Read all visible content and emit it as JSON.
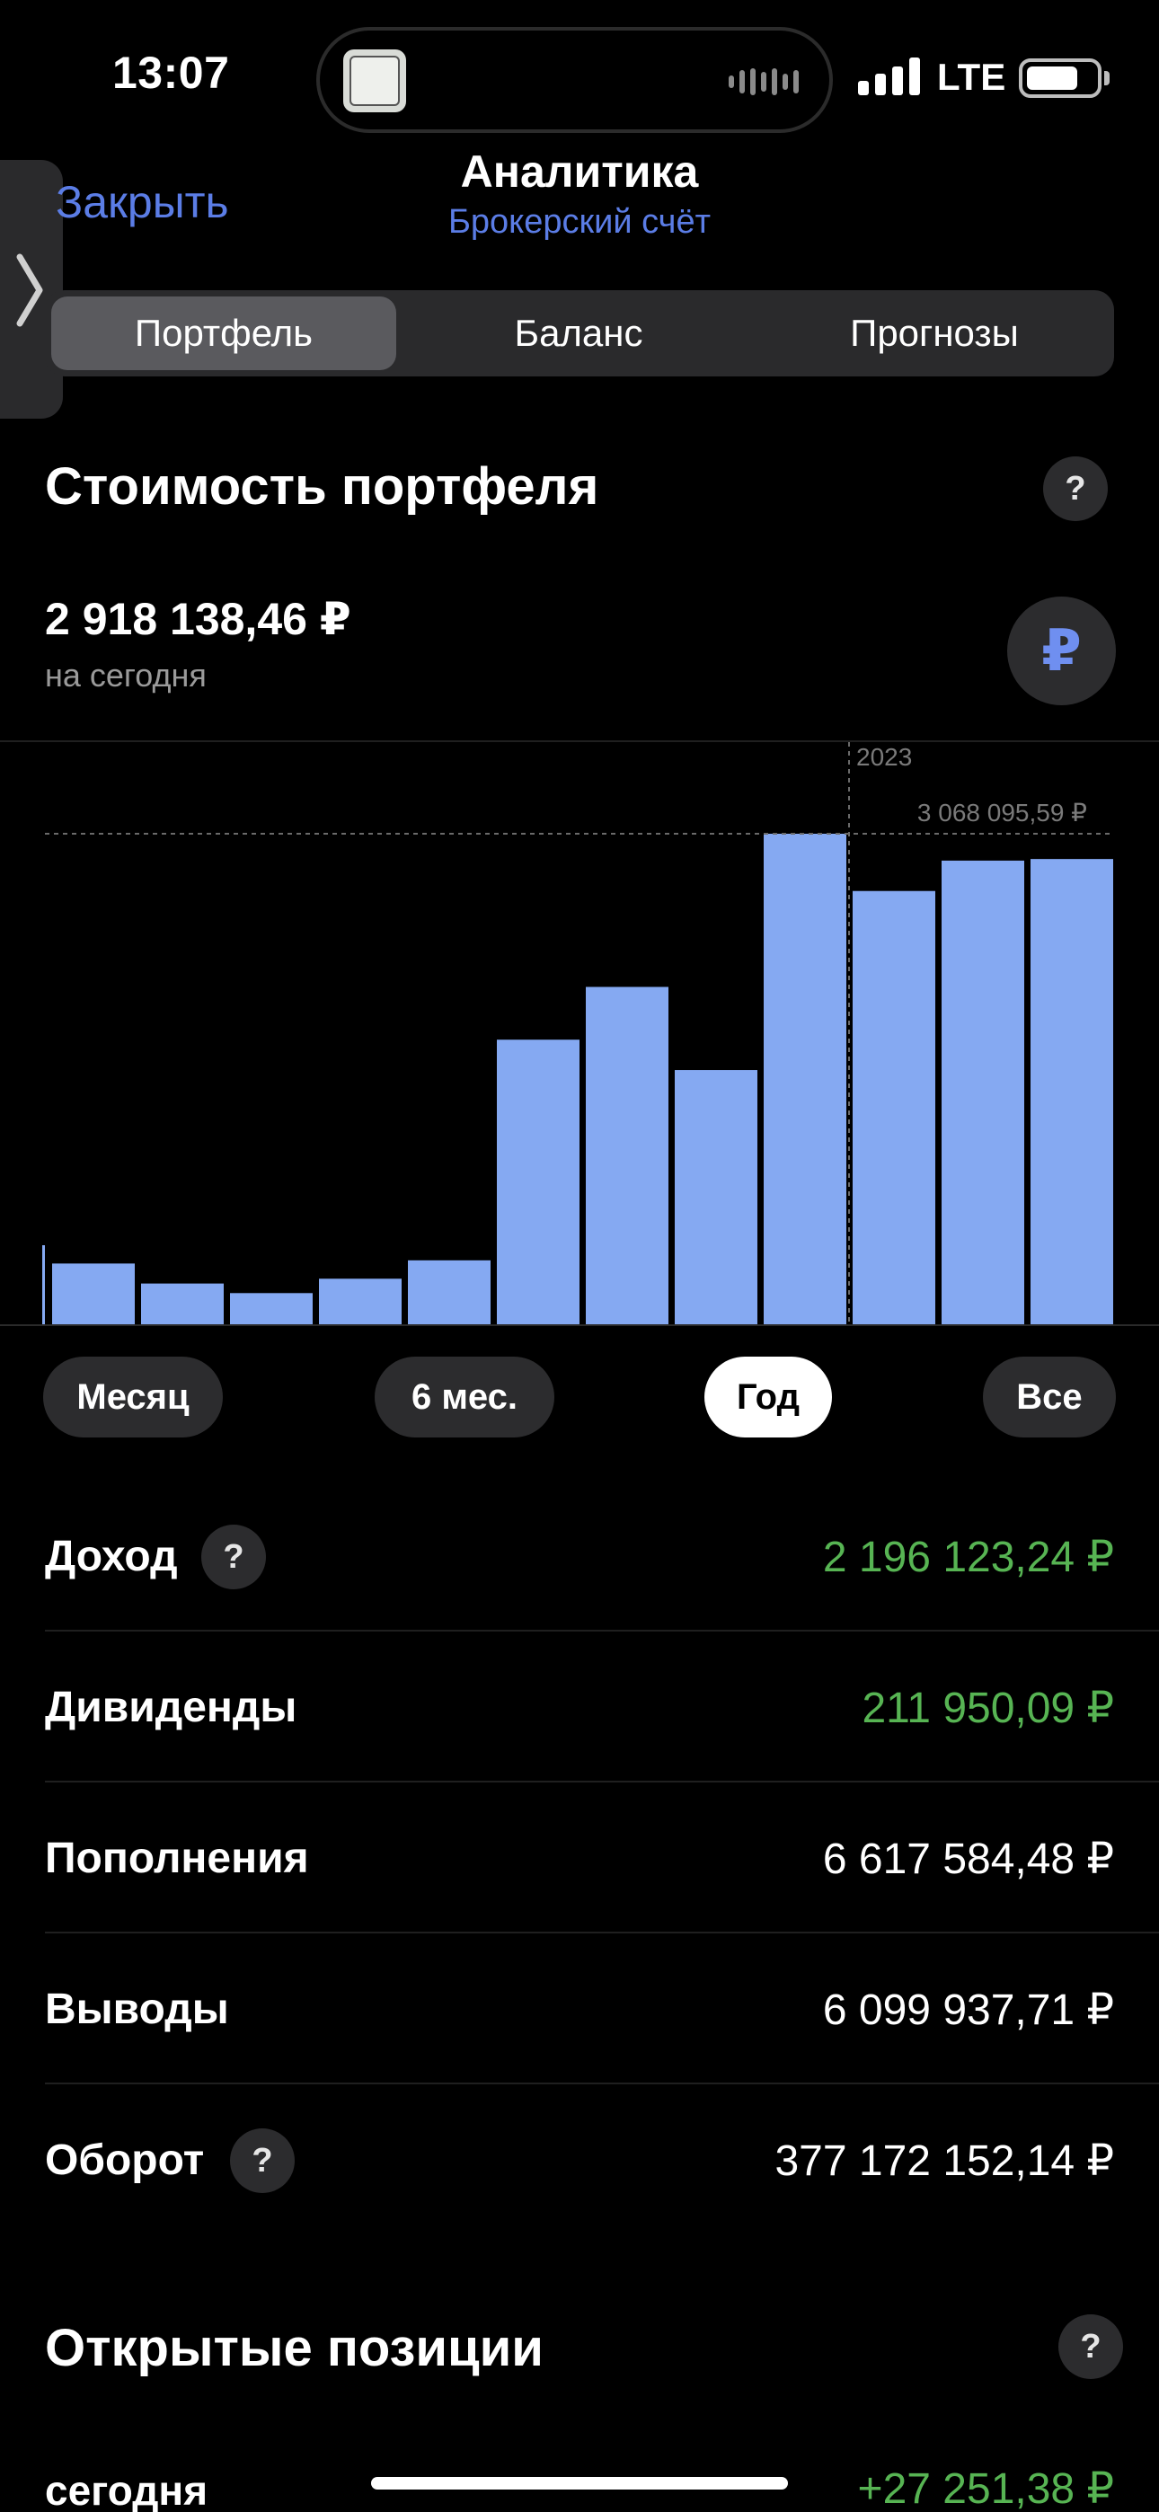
{
  "status_bar": {
    "time": "13:07",
    "network": "LTE",
    "now_playing_art_icon": "album-art-icon",
    "battery_level_percent": 75
  },
  "header": {
    "close_label": "Закрыть",
    "title": "Аналитика",
    "subtitle": "Брокерский счёт"
  },
  "tabs": [
    {
      "label": "Портфель",
      "active": true
    },
    {
      "label": "Баланс",
      "active": false
    },
    {
      "label": "Прогнозы",
      "active": false
    }
  ],
  "portfolio": {
    "title": "Стоимость портфеля",
    "help_label": "?",
    "value": "2 918 138,46 ₽",
    "value_caption": "на сегодня",
    "currency_button": "₽"
  },
  "chart_data": {
    "type": "bar",
    "marker_label": "2023",
    "max_label": "3 068 095,59 ₽",
    "max_value": 3068095.59,
    "values": [
      380000,
      255000,
      195000,
      285000,
      400000,
      1780000,
      2110000,
      1590000,
      3068095.59,
      2710000,
      2900000,
      2910000
    ],
    "ylim": [
      0,
      3068095.59
    ],
    "bar_color": "#85a9f2",
    "marker_after_index": 8
  },
  "periods": [
    {
      "label": "Месяц",
      "active": false
    },
    {
      "label": "6 мес.",
      "active": false
    },
    {
      "label": "Год",
      "active": true
    },
    {
      "label": "Все",
      "active": false
    }
  ],
  "stats": [
    {
      "label": "Доход",
      "value": "2 196 123,24 ₽",
      "help": true,
      "positive": true
    },
    {
      "label": "Дивиденды",
      "value": "211 950,09 ₽",
      "help": false,
      "positive": true
    },
    {
      "label": "Пополнения",
      "value": "6 617 584,48 ₽",
      "help": false,
      "positive": false
    },
    {
      "label": "Выводы",
      "value": "6 099 937,71 ₽",
      "help": false,
      "positive": false
    },
    {
      "label": "Оборот",
      "value": "377 172 152,14 ₽",
      "help": true,
      "positive": false
    }
  ],
  "open_positions": {
    "title": "Открытые позиции",
    "help_label": "?",
    "today_label": "сегодня",
    "today_value": "+27 251,38 ₽"
  },
  "colors": {
    "accent": "#5b7de6",
    "positive": "#57b453",
    "bar": "#85a9f2"
  }
}
